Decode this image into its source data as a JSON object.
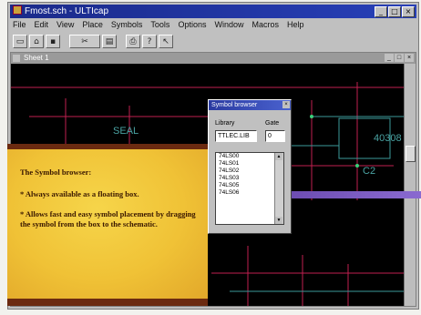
{
  "app": {
    "title": "Fmost.sch - ULTIcap",
    "window_buttons": [
      "_",
      "□",
      "×"
    ]
  },
  "menu": [
    "File",
    "Edit",
    "View",
    "Place",
    "Symbols",
    "Tools",
    "Options",
    "Window",
    "Macros",
    "Help"
  ],
  "document": {
    "title": "Sheet 1",
    "buttons": [
      "_",
      "□",
      "×"
    ]
  },
  "schematic": {
    "labels": [
      "SEAL",
      "40308",
      "C2"
    ]
  },
  "note": {
    "heading": "The Symbol browser:",
    "bullets": [
      "* Always available as a floating box.",
      "* Allows fast and easy symbol placement by dragging the symbol from the box to the schematic."
    ]
  },
  "symbol_browser": {
    "title": "Symbol browser",
    "library_label": "Library",
    "library_value": "TTLEC.LIB",
    "gate_label": "Gate",
    "gate_value": "0",
    "items": [
      "74LS00",
      "74LS01",
      "74LS02",
      "74LS03",
      "74LS05",
      "74LS06"
    ]
  },
  "colors": {
    "title_bar": "#1a2a8a",
    "canvas": "#000000",
    "note_bg": "#f0c236",
    "wire_red": "#c02050",
    "wire_cyan": "#4aa3a3"
  }
}
